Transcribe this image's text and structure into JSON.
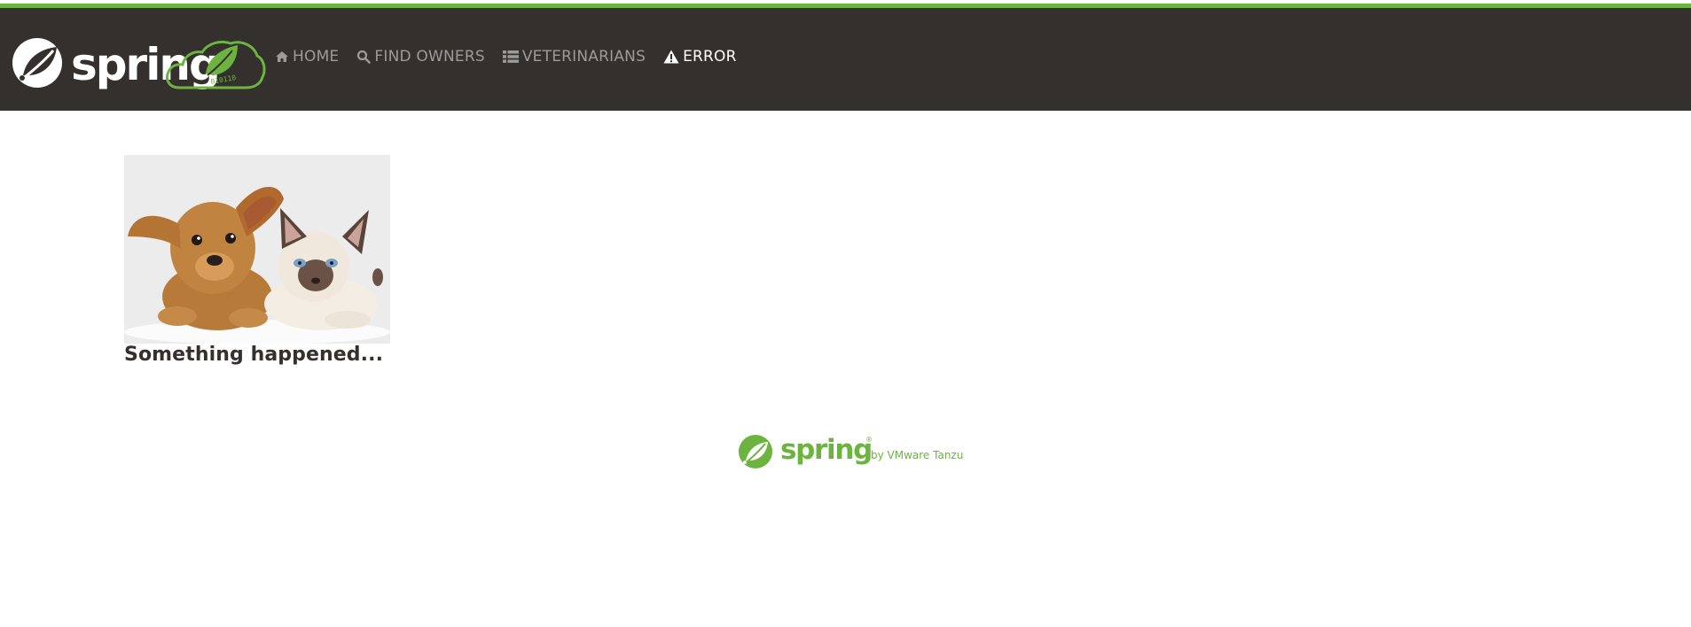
{
  "brand": {
    "logo_text": "spring",
    "cloud_text": "010110"
  },
  "nav": {
    "items": [
      {
        "label": "HOME",
        "icon": "home-icon",
        "active": false
      },
      {
        "label": "FIND OWNERS",
        "icon": "search-icon",
        "active": false
      },
      {
        "label": "VETERINARIANS",
        "icon": "list-icon",
        "active": false
      },
      {
        "label": "ERROR",
        "icon": "warning-icon",
        "active": true
      }
    ]
  },
  "main": {
    "headline": "Something happened..."
  },
  "footer": {
    "logo_text": "spring",
    "registered": "®",
    "byline": "by VMware Tanzu"
  },
  "colors": {
    "navbar_bg": "#34302d",
    "accent_green": "#6db33f",
    "nav_text": "#9b9b9b",
    "nav_active": "#ffffff",
    "headline": "#34302d"
  }
}
